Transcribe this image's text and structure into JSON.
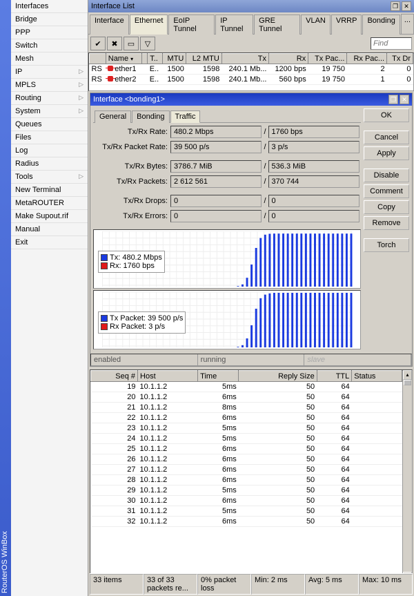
{
  "app_title": "RouterOS WinBox",
  "sidebar": {
    "items": [
      {
        "label": "Interfaces",
        "arrow": false
      },
      {
        "label": "Bridge",
        "arrow": false
      },
      {
        "label": "PPP",
        "arrow": false
      },
      {
        "label": "Switch",
        "arrow": false
      },
      {
        "label": "Mesh",
        "arrow": false
      },
      {
        "label": "IP",
        "arrow": true
      },
      {
        "label": "MPLS",
        "arrow": true
      },
      {
        "label": "Routing",
        "arrow": true
      },
      {
        "label": "System",
        "arrow": true
      },
      {
        "label": "Queues",
        "arrow": false
      },
      {
        "label": "Files",
        "arrow": false
      },
      {
        "label": "Log",
        "arrow": false
      },
      {
        "label": "Radius",
        "arrow": false
      },
      {
        "label": "Tools",
        "arrow": true
      },
      {
        "label": "New Terminal",
        "arrow": false
      },
      {
        "label": "MetaROUTER",
        "arrow": false
      },
      {
        "label": "Make Supout.rif",
        "arrow": false
      },
      {
        "label": "Manual",
        "arrow": false
      },
      {
        "label": "Exit",
        "arrow": false
      }
    ]
  },
  "iflist": {
    "title": "Interface List",
    "find_placeholder": "Find",
    "tabs": [
      "Interface",
      "Ethernet",
      "EoIP Tunnel",
      "IP Tunnel",
      "GRE Tunnel",
      "VLAN",
      "VRRP",
      "Bonding"
    ],
    "active_tab": 1,
    "columns": [
      "",
      "Name",
      "",
      "T..",
      "MTU",
      "L2 MTU",
      "Tx",
      "Rx",
      "Tx Pac...",
      "Rx Pac...",
      "Tx Dr"
    ],
    "rows": [
      {
        "flag": "RS",
        "name": "ether1",
        "type": "E..",
        "mtu": "1500",
        "l2mtu": "1598",
        "tx": "240.1 Mb...",
        "rx": "1200 bps",
        "txp": "19 750",
        "rxp": "2",
        "txd": "0"
      },
      {
        "flag": "RS",
        "name": "ether2",
        "type": "E..",
        "mtu": "1500",
        "l2mtu": "1598",
        "tx": "240.1 Mb...",
        "rx": "560 bps",
        "txp": "19 750",
        "rxp": "1",
        "txd": "0"
      }
    ]
  },
  "ifdialog": {
    "title": "Interface <bonding1>",
    "tabs": [
      "General",
      "Bonding",
      "Traffic"
    ],
    "active_tab": 2,
    "buttons": [
      "OK",
      "Cancel",
      "Apply",
      "Disable",
      "Comment",
      "Copy",
      "Remove",
      "Torch"
    ],
    "stats": [
      {
        "label": "Tx/Rx Rate:",
        "tx": "480.2 Mbps",
        "rx": "1760 bps"
      },
      {
        "label": "Tx/Rx Packet Rate:",
        "tx": "39 500 p/s",
        "rx": "3 p/s"
      },
      {
        "label": "Tx/Rx Bytes:",
        "tx": "3786.7 MiB",
        "rx": "536.3 MiB"
      },
      {
        "label": "Tx/Rx Packets:",
        "tx": "2 612 561",
        "rx": "370 744"
      },
      {
        "label": "Tx/Rx Drops:",
        "tx": "0",
        "rx": "0"
      },
      {
        "label": "Tx/Rx Errors:",
        "tx": "0",
        "rx": "0"
      }
    ],
    "chart1_legend": [
      {
        "color": "#1a3ae0",
        "label": "Tx: 480.2 Mbps"
      },
      {
        "color": "#e01a1a",
        "label": "Rx: 1760 bps"
      }
    ],
    "chart2_legend": [
      {
        "color": "#1a3ae0",
        "label": "Tx Packet: 39 500 p/s"
      },
      {
        "color": "#e01a1a",
        "label": "Rx Packet: 3 p/s"
      }
    ],
    "status": [
      "enabled",
      "running",
      "slave"
    ]
  },
  "ping": {
    "columns": [
      "Seq #",
      "Host",
      "Time",
      "Reply Size",
      "TTL",
      "Status"
    ],
    "rows": [
      {
        "seq": "19",
        "host": "10.1.1.2",
        "time": "5ms",
        "size": "50",
        "ttl": "64",
        "status": ""
      },
      {
        "seq": "20",
        "host": "10.1.1.2",
        "time": "6ms",
        "size": "50",
        "ttl": "64",
        "status": ""
      },
      {
        "seq": "21",
        "host": "10.1.1.2",
        "time": "8ms",
        "size": "50",
        "ttl": "64",
        "status": ""
      },
      {
        "seq": "22",
        "host": "10.1.1.2",
        "time": "6ms",
        "size": "50",
        "ttl": "64",
        "status": ""
      },
      {
        "seq": "23",
        "host": "10.1.1.2",
        "time": "5ms",
        "size": "50",
        "ttl": "64",
        "status": ""
      },
      {
        "seq": "24",
        "host": "10.1.1.2",
        "time": "5ms",
        "size": "50",
        "ttl": "64",
        "status": ""
      },
      {
        "seq": "25",
        "host": "10.1.1.2",
        "time": "6ms",
        "size": "50",
        "ttl": "64",
        "status": ""
      },
      {
        "seq": "26",
        "host": "10.1.1.2",
        "time": "6ms",
        "size": "50",
        "ttl": "64",
        "status": ""
      },
      {
        "seq": "27",
        "host": "10.1.1.2",
        "time": "6ms",
        "size": "50",
        "ttl": "64",
        "status": ""
      },
      {
        "seq": "28",
        "host": "10.1.1.2",
        "time": "6ms",
        "size": "50",
        "ttl": "64",
        "status": ""
      },
      {
        "seq": "29",
        "host": "10.1.1.2",
        "time": "5ms",
        "size": "50",
        "ttl": "64",
        "status": ""
      },
      {
        "seq": "30",
        "host": "10.1.1.2",
        "time": "6ms",
        "size": "50",
        "ttl": "64",
        "status": ""
      },
      {
        "seq": "31",
        "host": "10.1.1.2",
        "time": "5ms",
        "size": "50",
        "ttl": "64",
        "status": ""
      },
      {
        "seq": "32",
        "host": "10.1.1.2",
        "time": "6ms",
        "size": "50",
        "ttl": "64",
        "status": ""
      }
    ],
    "status": [
      "33 items",
      "33 of 33 packets re...",
      "0% packet loss",
      "Min: 2 ms",
      "Avg: 5 ms",
      "Max: 10 ms"
    ]
  },
  "chart_data": [
    {
      "type": "area",
      "title": "Tx/Rx Rate",
      "series": [
        {
          "name": "Tx",
          "values": [
            0,
            0,
            0,
            0,
            0,
            0,
            0,
            0,
            0,
            0,
            0,
            0,
            0,
            0,
            0,
            0,
            0,
            0,
            0,
            0,
            0,
            0,
            0,
            0,
            0,
            0,
            0,
            0,
            0,
            0,
            5,
            20,
            80,
            200,
            350,
            440,
            470,
            478,
            480,
            480,
            480,
            480,
            480,
            480,
            480,
            480,
            480,
            480,
            480,
            480,
            480,
            480,
            480,
            480,
            480,
            480
          ],
          "unit": "Mbps"
        },
        {
          "name": "Rx",
          "values": [
            0,
            0,
            0,
            0,
            0,
            0,
            0,
            0,
            0,
            0,
            0,
            0,
            0,
            0,
            0,
            0,
            0,
            0,
            0,
            0,
            0,
            0,
            0,
            0,
            0,
            0,
            0,
            0,
            0,
            0,
            0,
            0,
            0,
            0,
            0,
            0,
            0,
            0,
            0,
            0,
            0,
            0,
            0,
            0,
            0,
            0,
            0,
            0,
            0,
            0,
            0,
            0,
            0,
            0,
            0,
            0
          ],
          "unit": "bps"
        }
      ],
      "ylim": [
        0,
        500
      ]
    },
    {
      "type": "area",
      "title": "Tx/Rx Packet Rate",
      "series": [
        {
          "name": "Tx Packet",
          "values": [
            0,
            0,
            0,
            0,
            0,
            0,
            0,
            0,
            0,
            0,
            0,
            0,
            0,
            0,
            0,
            0,
            0,
            0,
            0,
            0,
            0,
            0,
            0,
            0,
            0,
            0,
            0,
            0,
            0,
            0,
            400,
            1600,
            6500,
            16000,
            28000,
            35600,
            38200,
            39100,
            39500,
            39500,
            39500,
            39500,
            39500,
            39500,
            39500,
            39500,
            39500,
            39500,
            39500,
            39500,
            39500,
            39500,
            39500,
            39500,
            39500,
            39500
          ],
          "unit": "p/s"
        },
        {
          "name": "Rx Packet",
          "values": [
            0,
            0,
            0,
            0,
            0,
            0,
            0,
            0,
            0,
            0,
            0,
            0,
            0,
            0,
            0,
            0,
            0,
            0,
            0,
            0,
            0,
            0,
            0,
            0,
            0,
            0,
            0,
            0,
            0,
            0,
            0,
            0,
            0,
            0,
            0,
            0,
            0,
            0,
            0,
            0,
            0,
            0,
            0,
            0,
            0,
            0,
            0,
            0,
            0,
            0,
            0,
            0,
            0,
            0,
            0,
            0
          ],
          "unit": "p/s"
        }
      ],
      "ylim": [
        0,
        40000
      ]
    }
  ]
}
